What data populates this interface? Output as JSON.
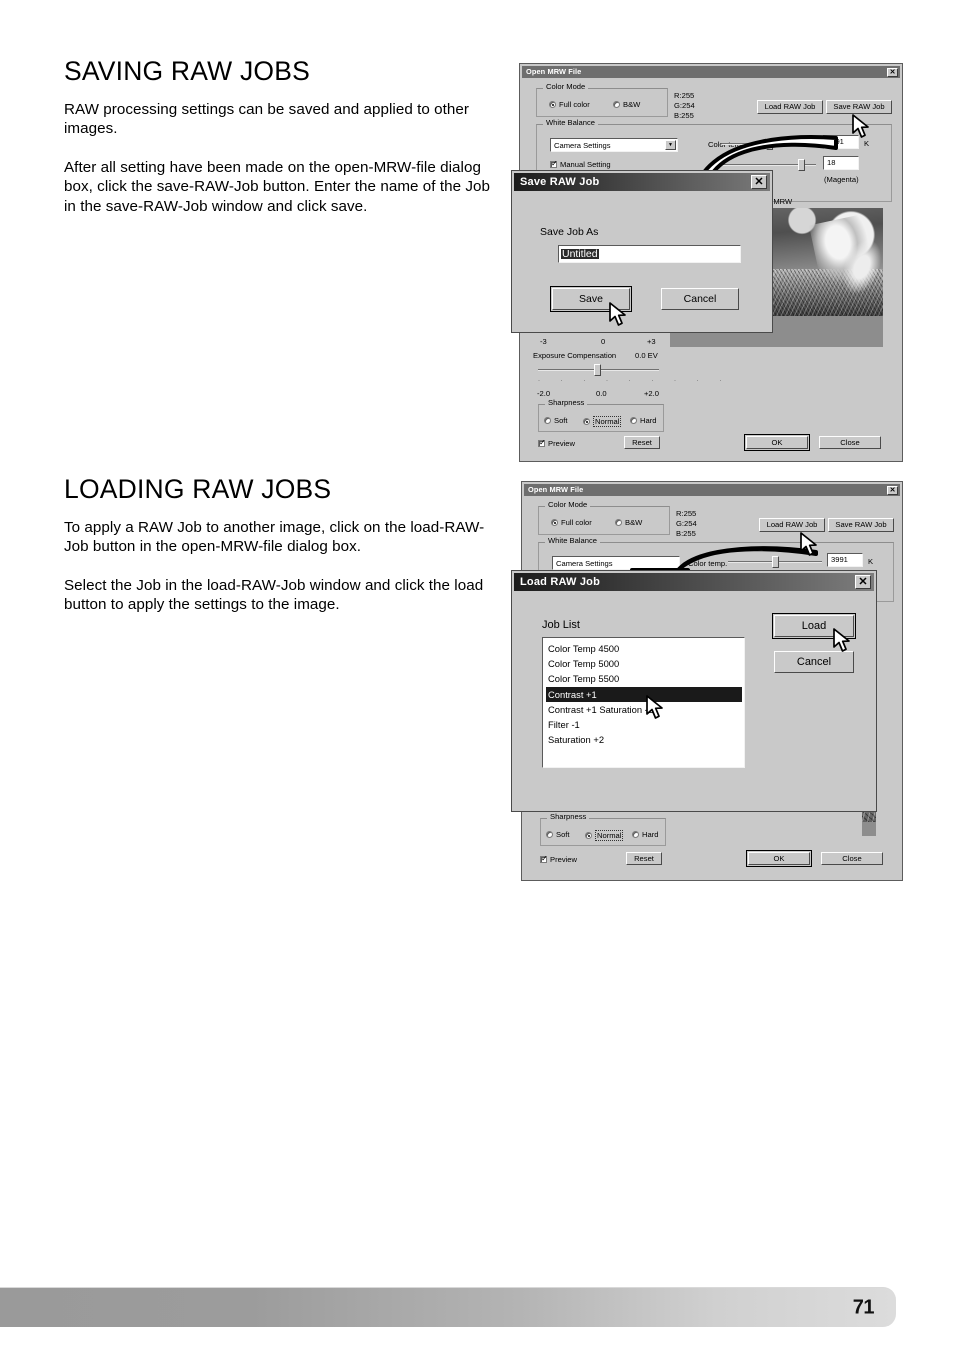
{
  "page": {
    "number": "71"
  },
  "sections": [
    {
      "heading": "SAVING RAW JOBS",
      "paragraphs": [
        "RAW processing settings can be saved and applied to other images.",
        "After all setting have been made on the open-MRW-file dialog box, click the save-RAW-Job button. Enter the name of the Job in the save-RAW-Job window and click save."
      ]
    },
    {
      "heading": "LOADING RAW JOBS",
      "paragraphs": [
        "To apply a RAW Job to another image, click on the load-RAW-Job button in the open-MRW-file dialog box.",
        "Select the Job in the load-RAW-Job window and click the load button to apply the settings to the image."
      ]
    }
  ],
  "shot1": {
    "dialog": {
      "title": "Open MRW File",
      "close": "✕",
      "color_mode": {
        "legend": "Color Mode",
        "options": [
          "Full color",
          "B&W"
        ],
        "selected": "Full color"
      },
      "rgb_readout": [
        "R:255",
        "G:254",
        "B:255"
      ],
      "buttons": {
        "load": "Load RAW Job",
        "save": "Save RAW Job"
      },
      "white_balance": {
        "legend": "White Balance",
        "preset": "Camera Settings",
        "manual_label": "Manual Setting",
        "manual_checked": true,
        "color_temp_label": "Color temp.",
        "color_temp_value": "3991",
        "color_temp_unit": "K",
        "tint_value": "18",
        "tint_label": "(Magenta)"
      },
      "filename": "1.MRW",
      "exposure": {
        "top_ticks": [
          "-3",
          "0",
          "+3"
        ],
        "label": "Exposure Compensation",
        "value": "0.0 EV",
        "bottom_ticks": [
          "-2.0",
          "0.0",
          "+2.0"
        ]
      },
      "sharpness": {
        "legend": "Sharpness",
        "options": [
          "Soft",
          "Normal",
          "Hard"
        ],
        "selected": "Normal"
      },
      "preview_label": "Preview",
      "preview_checked": true,
      "reset": "Reset",
      "ok": "OK",
      "close_btn": "Close"
    },
    "modal": {
      "title": "Save RAW Job",
      "close": "✕",
      "field_label": "Save Job As",
      "field_value": "Untitled",
      "save": "Save",
      "cancel": "Cancel"
    }
  },
  "shot2": {
    "dialog": {
      "title": "Open MRW File",
      "close": "✕",
      "color_mode": {
        "legend": "Color Mode",
        "options": [
          "Full color",
          "B&W"
        ],
        "selected": "Full color"
      },
      "rgb_readout": [
        "R:255",
        "G:254",
        "B:255"
      ],
      "buttons": {
        "load": "Load RAW Job",
        "save": "Save RAW Job"
      },
      "white_balance": {
        "legend": "White Balance",
        "preset": "Camera Settings",
        "color_temp_label": "Color temp.",
        "color_temp_value": "3991",
        "color_temp_unit": "K"
      },
      "sharpness": {
        "legend": "Sharpness",
        "options": [
          "Soft",
          "Normal",
          "Hard"
        ],
        "selected": "Normal"
      },
      "preview_label": "Preview",
      "preview_checked": true,
      "reset": "Reset",
      "ok": "OK",
      "close_btn": "Close"
    },
    "modal": {
      "title": "Load RAW Job",
      "close": "✕",
      "list_label": "Job List",
      "jobs": [
        "Color Temp 4500",
        "Color Temp 5000",
        "Color Temp 5500",
        "Contrast +1",
        "Contrast +1 Saturation -2",
        "Filter -1",
        "Saturation +2"
      ],
      "selected_job": "Contrast +1",
      "load": "Load",
      "cancel": "Cancel"
    }
  }
}
